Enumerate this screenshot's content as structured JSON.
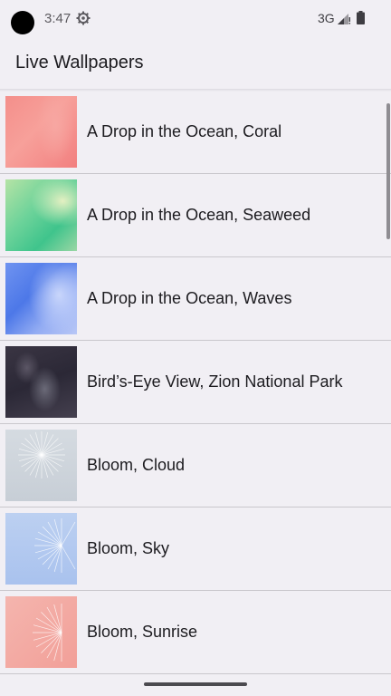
{
  "status_bar": {
    "time": "3:47",
    "network": "3G",
    "icons": [
      "gear-icon",
      "signal-icon",
      "battery-icon"
    ]
  },
  "app_bar": {
    "title": "Live Wallpapers"
  },
  "wallpapers": [
    {
      "label": "A Drop in the Ocean, Coral"
    },
    {
      "label": "A Drop in the Ocean, Seaweed"
    },
    {
      "label": "A Drop in the Ocean, Waves"
    },
    {
      "label": "Bird’s-Eye View, Zion National Park"
    },
    {
      "label": "Bloom, Cloud"
    },
    {
      "label": "Bloom, Sky"
    },
    {
      "label": "Bloom, Sunrise"
    }
  ],
  "colors": {
    "background": "#f1eff4",
    "divider": "#c9c7cc",
    "text": "#1c1b1f"
  }
}
